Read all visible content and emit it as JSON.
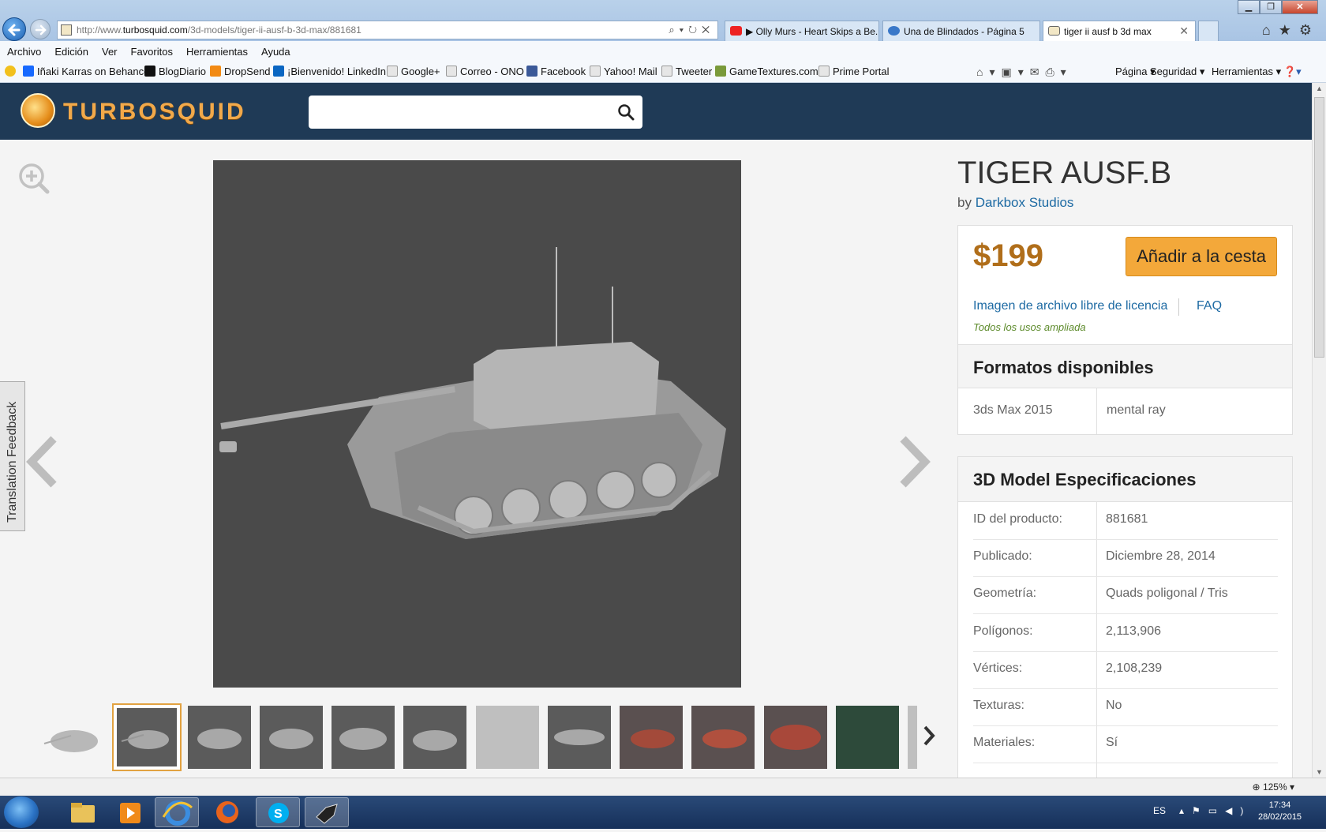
{
  "browser": {
    "url_prefix": "http://www.",
    "url_domain": "turbosquid.com",
    "url_path": "/3d-models/tiger-ii-ausf-b-3d-max/881681",
    "tabs": [
      {
        "label": "▶ Olly Murs - Heart Skips a Be...",
        "icon": "youtube-icon"
      },
      {
        "label": "Una de Blindados - Página 5",
        "icon": "ie-icon"
      },
      {
        "label": "tiger ii ausf b 3d max",
        "icon": "turbosquid-icon"
      }
    ],
    "menu": [
      "Archivo",
      "Edición",
      "Ver",
      "Favoritos",
      "Herramientas",
      "Ayuda"
    ],
    "favorites": [
      "Iñaki Karras on Behance",
      "BlogDiario",
      "DropSend",
      "¡Bienvenido! LinkedIn",
      "Google+",
      "Correo - ONO",
      "Facebook",
      "Yahoo! Mail",
      "Tweeter",
      "GameTextures.com",
      "Prime Portal"
    ],
    "commands": [
      "Página ▾",
      "Seguridad ▾",
      "Herramientas ▾"
    ],
    "zoom": "125%"
  },
  "site": {
    "logo": "TURBOSQUID",
    "search_placeholder": "",
    "feedback": "Translation Feedback"
  },
  "product": {
    "title": "TIGER AUSF.B",
    "by": "by",
    "author": "Darkbox Studios",
    "price": "$199",
    "add_to_cart": "Añadir a la cesta",
    "license": "Imagen de archivo libre de licencia",
    "faq": "FAQ",
    "uses": "Todos los usos ampliada",
    "formats_heading": "Formatos disponibles",
    "formats": [
      "3ds Max 2015",
      "mental ray"
    ],
    "specs_heading": "3D Model Especificaciones",
    "specs": [
      {
        "k": "ID del producto:",
        "v": "881681"
      },
      {
        "k": "Publicado:",
        "v": "Diciembre 28, 2014"
      },
      {
        "k": "Geometría:",
        "v": "Quads poligonal / Tris"
      },
      {
        "k": "Polígonos:",
        "v": "2,113,906"
      },
      {
        "k": "Vértices:",
        "v": "2,108,239"
      },
      {
        "k": "Texturas:",
        "v": "No"
      },
      {
        "k": "Materiales:",
        "v": "Sí"
      }
    ]
  },
  "system": {
    "lang": "ES",
    "time": "17:34",
    "date": "28/02/2015"
  },
  "colors": {
    "header": "#1f3a56",
    "accent": "#f3a83a",
    "price": "#b06e1a",
    "link": "#1d6aa3"
  }
}
